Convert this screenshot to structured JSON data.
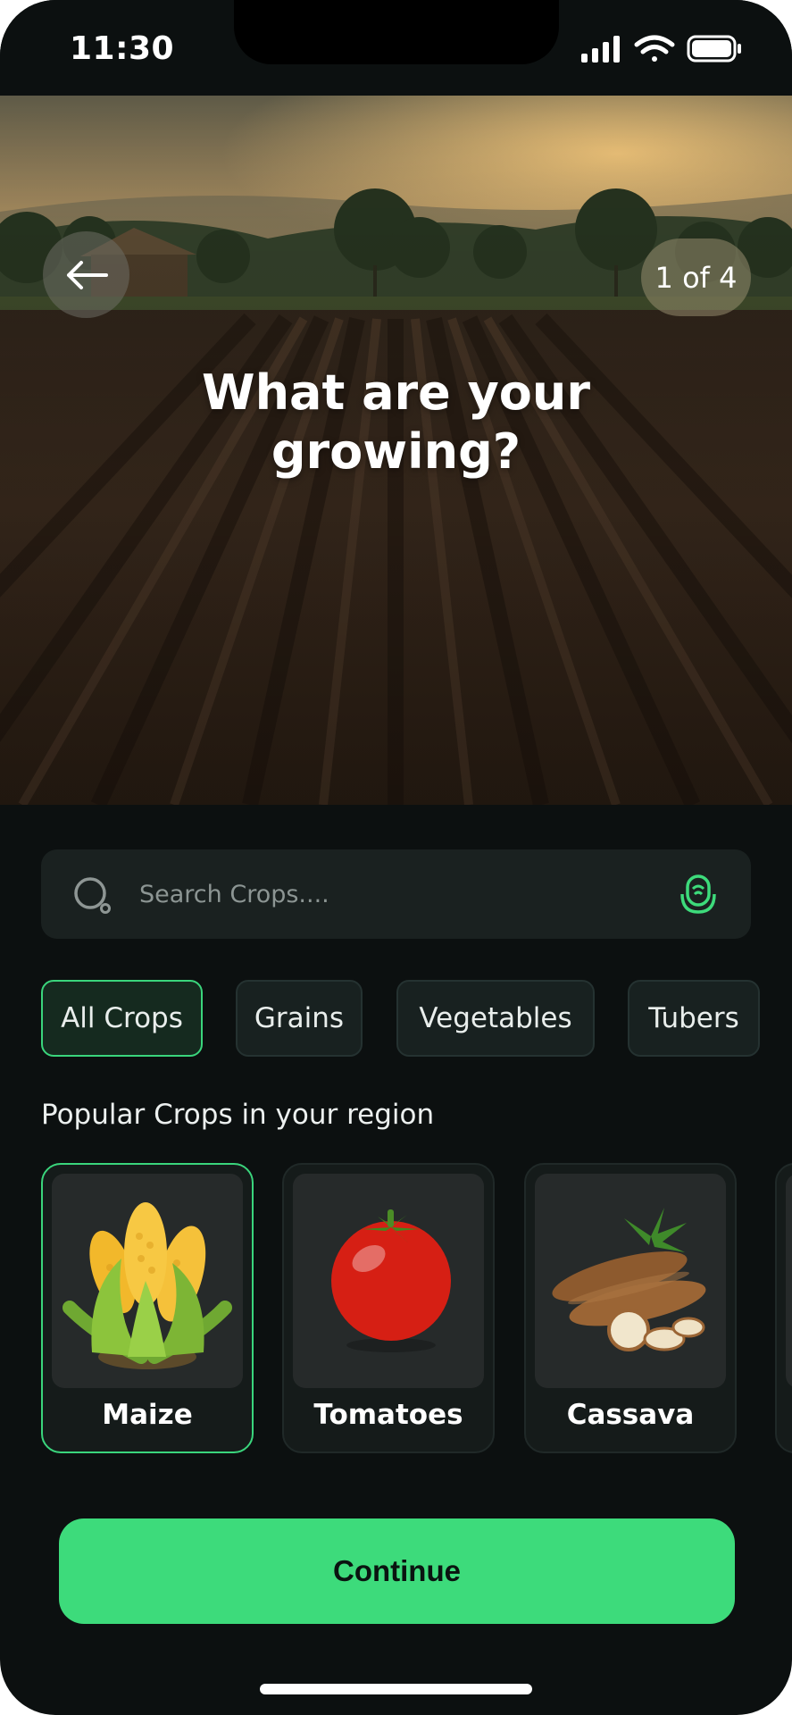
{
  "status_bar": {
    "time": "11:30"
  },
  "header": {
    "step_label": "1 of 4",
    "title_line1": "What are your",
    "title_line2": "growing?"
  },
  "search": {
    "placeholder": "Search Crops...."
  },
  "filters": [
    {
      "label": "All Crops",
      "active": true
    },
    {
      "label": "Grains",
      "active": false
    },
    {
      "label": "Vegetables",
      "active": false
    },
    {
      "label": "Tubers",
      "active": false
    }
  ],
  "section_title": "Popular Crops in your region",
  "crops": [
    {
      "name": "Maize",
      "selected": true
    },
    {
      "name": "Tomatoes",
      "selected": false
    },
    {
      "name": "Cassava",
      "selected": false
    }
  ],
  "continue_label": "Continue",
  "colors": {
    "accent": "#3ddb7b",
    "background": "#0c1010"
  }
}
